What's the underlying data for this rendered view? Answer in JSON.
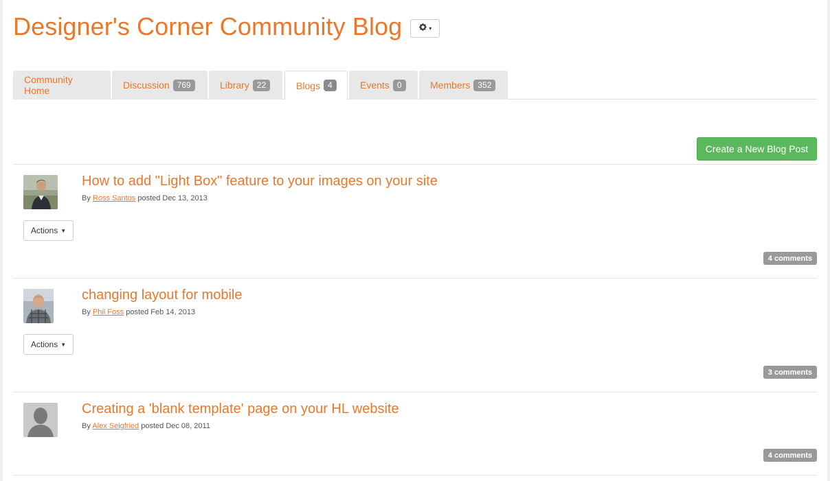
{
  "header": {
    "title": "Designer's Corner Community Blog",
    "gear_caret": "▾"
  },
  "tabs": [
    {
      "label": "Community Home",
      "count": ""
    },
    {
      "label": "Discussion",
      "count": "769"
    },
    {
      "label": "Library",
      "count": "22"
    },
    {
      "label": "Blogs",
      "count": "4",
      "active": true
    },
    {
      "label": "Events",
      "count": "0"
    },
    {
      "label": "Members",
      "count": "352"
    }
  ],
  "toolbar": {
    "create_label": "Create a New Blog Post"
  },
  "posts": [
    {
      "title": "How to add \"Light Box\" feature to your images on your site",
      "by": "By",
      "author": "Ross Santos",
      "posted": "posted Dec 13, 2013",
      "actions_label": "Actions",
      "comments": "4 comments"
    },
    {
      "title": "changing layout for mobile",
      "by": "By",
      "author": "Phil Foss",
      "posted": "posted Feb 14, 2013",
      "actions_label": "Actions",
      "comments": "3 comments"
    },
    {
      "title": "Creating a 'blank template' page on your HL website",
      "by": "By",
      "author": "Alex Seigfried",
      "posted": "posted Dec 08, 2011",
      "comments": "4 comments"
    }
  ],
  "colors": {
    "accent": "#e8782c",
    "create_button": "#5cb85c",
    "badge": "#999999"
  }
}
